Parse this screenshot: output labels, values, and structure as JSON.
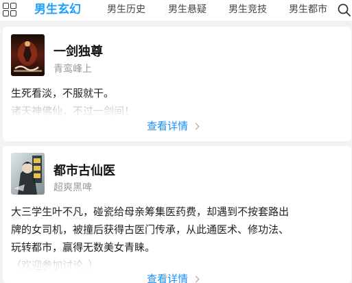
{
  "tabs": [
    {
      "label": "男生玄幻",
      "active": true
    },
    {
      "label": "男生历史",
      "active": false
    },
    {
      "label": "男生悬疑",
      "active": false
    },
    {
      "label": "男生竞技",
      "active": false
    },
    {
      "label": "男生都市",
      "active": false
    }
  ],
  "icons": {
    "menu": "grid-icon",
    "search": "search-icon",
    "chevron": "chevron-right-icon"
  },
  "colors": {
    "accent": "#1aa0ff",
    "link": "#1a8fff",
    "muted": "#999999"
  },
  "books": [
    {
      "title": "一剑独尊",
      "author": "青鸾峰上",
      "desc_lines": [
        "生死看淡，不服就干。"
      ],
      "faded_line": "诸天神佛仙，不过一剑间！",
      "link": "查看详情"
    },
    {
      "title": "都市古仙医",
      "author": "超爽黑啤",
      "desc_lines": [
        "大三学生叶不凡，碰瓷给母亲筹集医药费，却遇到不按套路出",
        "牌的女司机，被撞后获得古医门传承，从此通医术、修功法、",
        "玩转都市，赢得无数美女青睐。"
      ],
      "faded_line": "（欢迎参加讨论。）",
      "link": "查看详情"
    }
  ]
}
